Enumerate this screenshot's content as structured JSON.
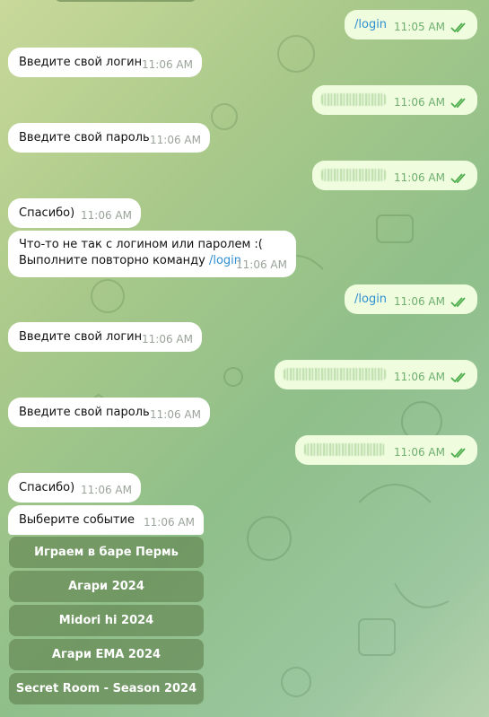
{
  "messages": [
    {
      "dir": "out",
      "text": "/login",
      "time": "11:05 AM",
      "link": true
    },
    {
      "dir": "in",
      "text": "Введите свой логин",
      "time": "11:06 AM"
    },
    {
      "dir": "out",
      "blurred": true,
      "time": "11:06 AM"
    },
    {
      "dir": "in",
      "text": "Введите свой пароль",
      "time": "11:06 AM"
    },
    {
      "dir": "out",
      "blurred": true,
      "time": "11:06 AM"
    },
    {
      "dir": "in",
      "text": "Спасибо)",
      "time": "11:06 AM"
    },
    {
      "dir": "in",
      "line1": "Что-то не так с логином или паролем :(",
      "line2_prefix": "Выполните повторно команду ",
      "line2_link": "/login",
      "time": "11:06 AM"
    },
    {
      "dir": "out",
      "text": "/login",
      "time": "11:06 AM",
      "link": true
    },
    {
      "dir": "in",
      "text": "Введите свой логин",
      "time": "11:06 AM"
    },
    {
      "dir": "out",
      "blurred": true,
      "time": "11:06 AM"
    },
    {
      "dir": "in",
      "text": "Введите свой пароль",
      "time": "11:06 AM"
    },
    {
      "dir": "out",
      "blurred": true,
      "time": "11:06 AM"
    },
    {
      "dir": "in",
      "text": "Спасибо)",
      "time": "11:06 AM"
    },
    {
      "dir": "in",
      "text": "Выберите событие",
      "time": "11:06 AM"
    }
  ],
  "keyboard": [
    "Играем в баре Пермь",
    "Агари 2024",
    "Midori hi 2024",
    "Агари ЕМА 2024",
    "Secret Room - Season 2024"
  ],
  "colors": {
    "incoming": "#ffffff",
    "outgoing": "#effdde",
    "link": "#2f8fd1",
    "check": "#4fae4e",
    "time_in": "#9aa39a",
    "time_out": "#6fae6f"
  },
  "icons": {
    "read_receipt": "double-check-icon"
  }
}
